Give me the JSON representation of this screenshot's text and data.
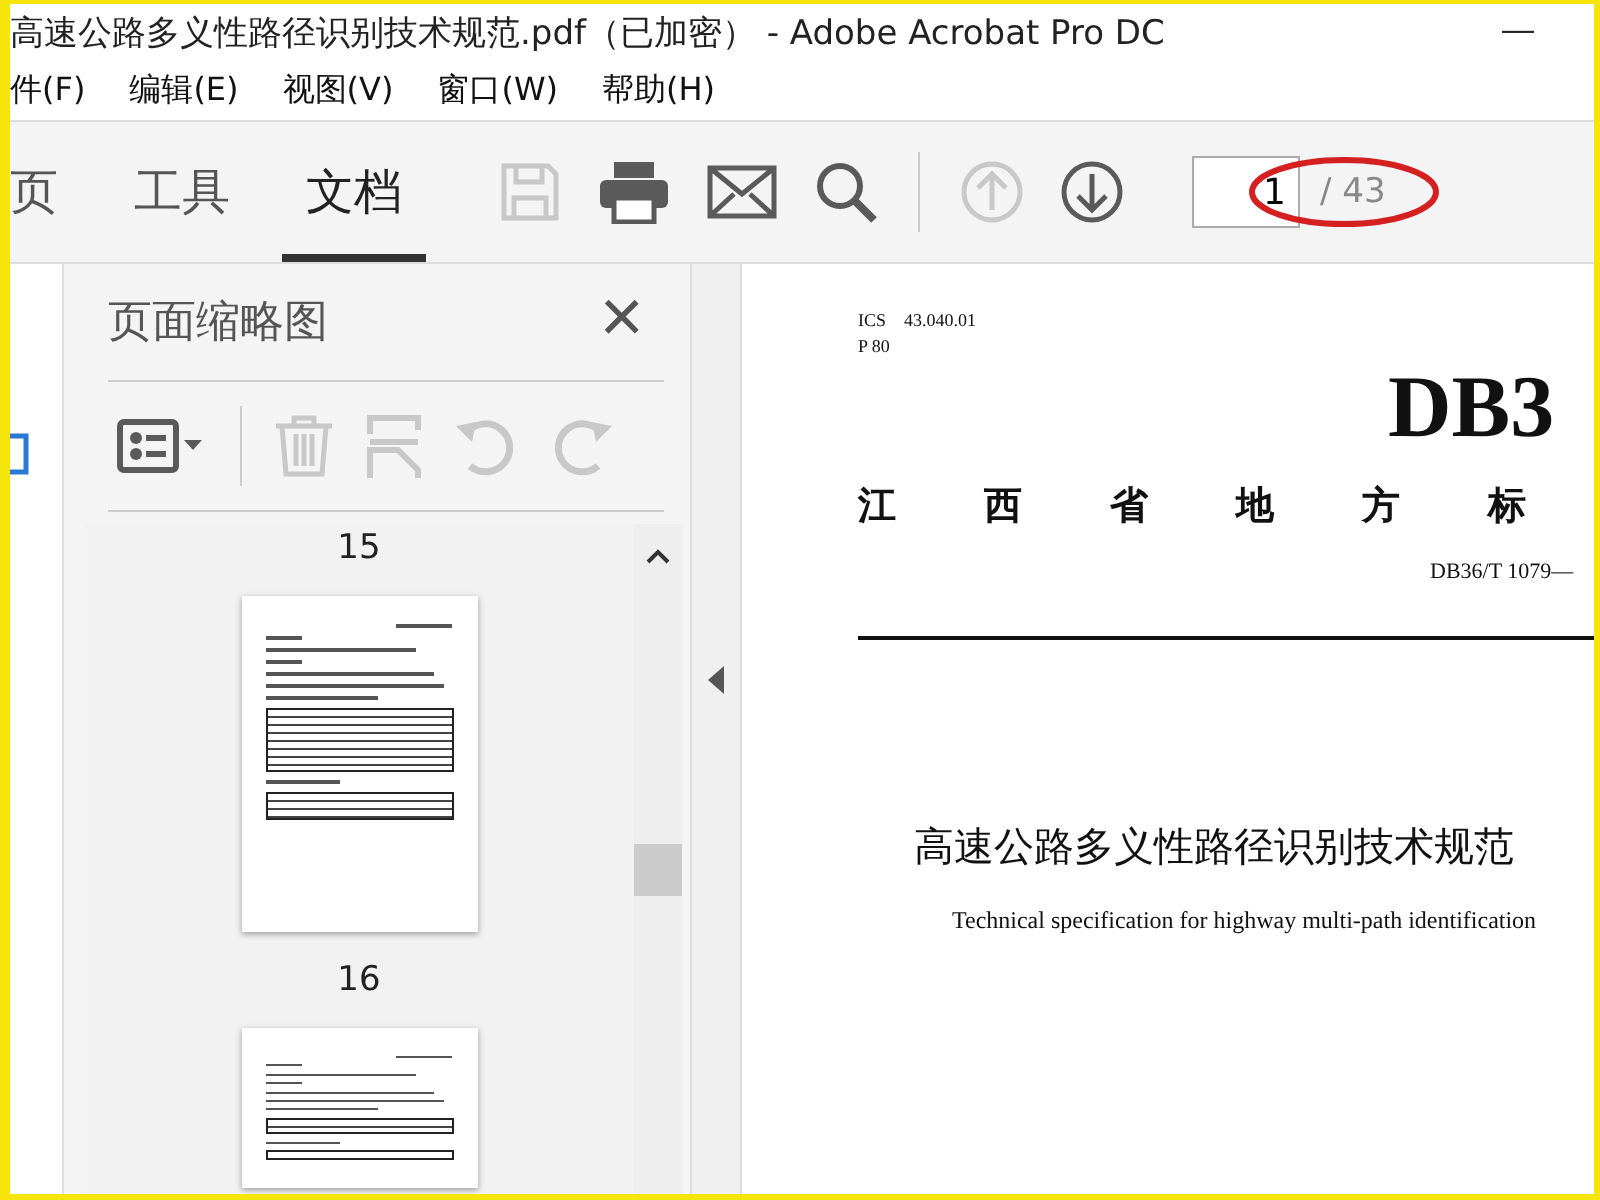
{
  "window": {
    "title": "高速公路多义性路径识别技术规范.pdf（已加密） - Adobe Acrobat Pro DC",
    "minimize": "—"
  },
  "menu": [
    {
      "label": "件(F)"
    },
    {
      "label": "编辑(E)"
    },
    {
      "label": "视图(V)"
    },
    {
      "label": "窗口(W)"
    },
    {
      "label": "帮助(H)"
    }
  ],
  "toolbar": {
    "tabs": [
      {
        "label": "页",
        "selected": false
      },
      {
        "label": "工具",
        "selected": false
      },
      {
        "label": "文档",
        "selected": true
      }
    ],
    "buttons": [
      {
        "kind": "save",
        "disabled": true
      },
      {
        "kind": "print",
        "disabled": false
      },
      {
        "kind": "mail",
        "disabled": false
      },
      {
        "kind": "search",
        "disabled": false
      }
    ],
    "nav": [
      {
        "kind": "prev",
        "disabled": true
      },
      {
        "kind": "next",
        "disabled": false
      }
    ],
    "page_number": "1",
    "page_total": "/ 43"
  },
  "thumbnails_panel": {
    "title": "页面缩略图",
    "close": "×",
    "tools": [
      {
        "kind": "options",
        "disabled": false
      },
      {
        "kind": "delete",
        "disabled": true
      },
      {
        "kind": "extract",
        "disabled": true
      },
      {
        "kind": "rotate-left",
        "disabled": true
      },
      {
        "kind": "rotate-right",
        "disabled": true
      }
    ],
    "pages": [
      {
        "label": "15"
      },
      {
        "label": "16"
      }
    ]
  },
  "document": {
    "ics": "ICS　43.040.01",
    "classification": "P 80",
    "code_large": "DB3",
    "authority": [
      "江",
      "西",
      "省",
      "地",
      "方",
      "标"
    ],
    "standard_number": "DB36/T 1079—",
    "title_cn": "高速公路多义性路径识别技术规范",
    "title_en": "Technical specification for highway multi-path identification"
  }
}
